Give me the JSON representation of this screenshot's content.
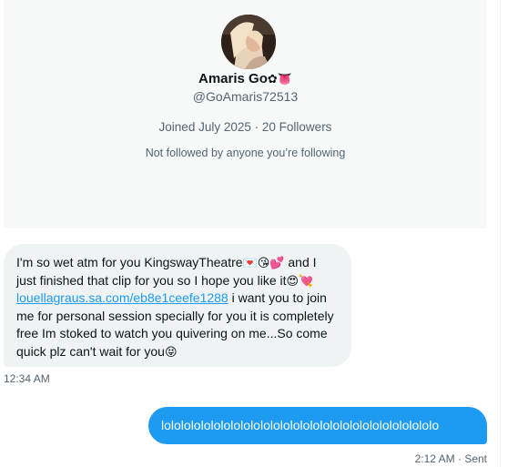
{
  "profile": {
    "display_name": "Amaris Go",
    "name_emojis": [
      "flower-emoji",
      "tongue-emoji"
    ],
    "handle": "@GoAmaris72513",
    "joined": "Joined July 2025",
    "separator": "·",
    "followers": "20 Followers",
    "not_followed": "Not followed by anyone you’re following"
  },
  "messages": {
    "incoming": {
      "part1": "I'm so wet atm for you KingswayTheatre",
      "part2": "and I just finished that clip for you so I hope you like it",
      "link": "louellagraus.sa.com/eb8e1ceefe1288",
      "part3": " i want you to join me for personal session specially for you it is completely free Im stoked to watch you quivering on me...So come quick plz can't wait for you",
      "emojis": [
        "love-letter-emoji",
        "kiss-emoji",
        "two-hearts-emoji",
        "heart-eyes-emoji",
        "heart-emoji",
        "tongue-wink-emoji"
      ],
      "time": "12:34 AM"
    },
    "outgoing": {
      "text": "lolololololololololololololololololololololololololololo",
      "time": "2:12 AM",
      "separator": "·",
      "status": "Sent"
    }
  },
  "colors": {
    "accent": "#1d9bf0",
    "secondary_text": "#536471",
    "incoming_bubble": "#eff3f4"
  }
}
